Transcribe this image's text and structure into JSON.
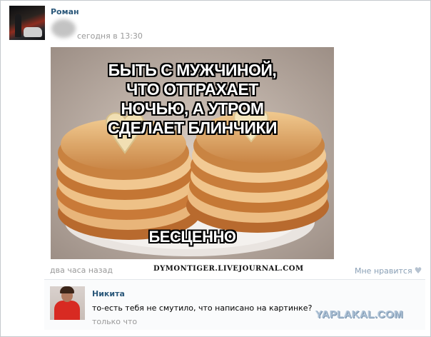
{
  "post": {
    "author": "Роман",
    "time": "сегодня в 13:30",
    "image_text_top": "БЫТЬ С МУЖЧИНОЙ, ЧТО ОТТРАХАЕТ НОЧЬЮ, А УТРОМ СДЕЛАЕТ БЛИНЧИКИ",
    "image_text_bottom": "БЕСЦЕННО",
    "footer_time": "два часа назад",
    "like_label": "Мне нравится",
    "like_icon": "heart-icon"
  },
  "comment": {
    "author": "Никита",
    "text": "то-есть тебя не смутило, что написано на картинке?",
    "time": "только что"
  },
  "watermarks": {
    "lj": "DYMONTIGER.LIVEJOURNAL.COM",
    "yaplakal": "YAPLAKAL.COM"
  },
  "colors": {
    "link": "#2b587a",
    "muted": "#999999",
    "like": "#8aa0b6"
  }
}
